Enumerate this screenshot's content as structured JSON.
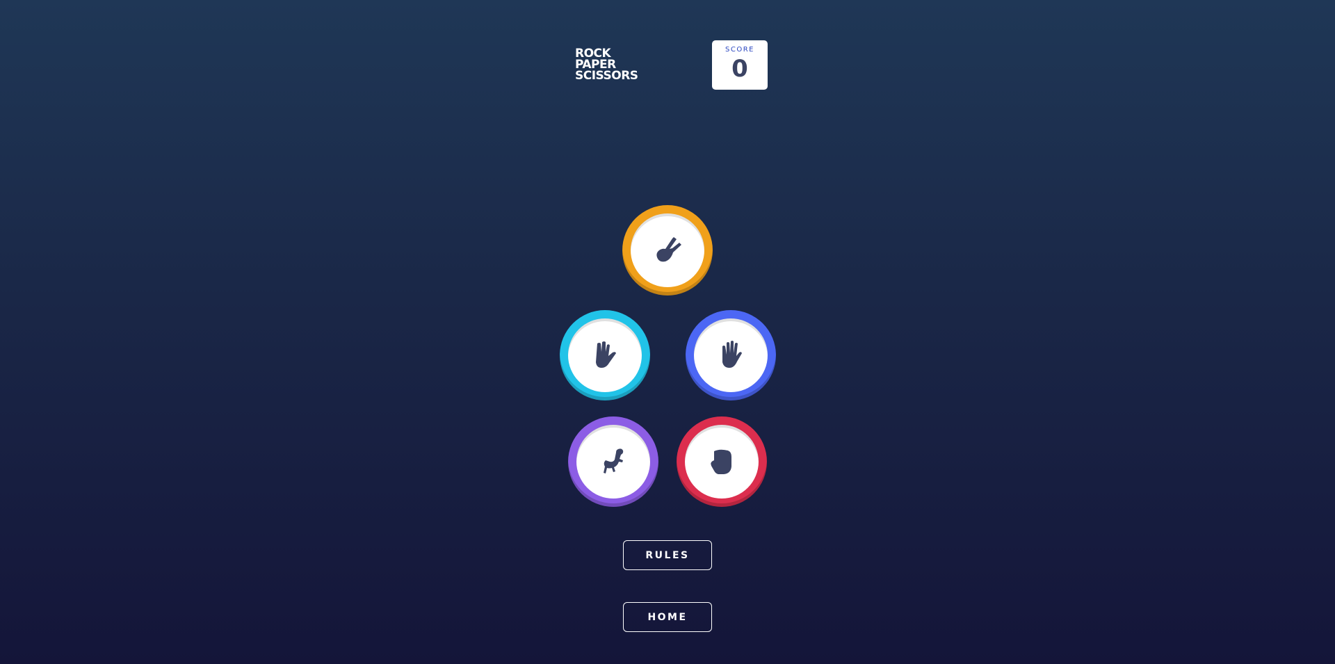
{
  "header": {
    "title_lines": [
      "ROCK",
      "PAPER",
      "SCISSORS"
    ],
    "score_label": "SCORE",
    "score_value": "0"
  },
  "tokens": [
    {
      "name": "scissors",
      "color": "#f0a01a",
      "icon": "scissors-icon"
    },
    {
      "name": "spock",
      "color": "#21c3e8",
      "icon": "spock-icon"
    },
    {
      "name": "paper",
      "color": "#4c67f4",
      "icon": "paper-icon"
    },
    {
      "name": "lizard",
      "color": "#8c5de5",
      "icon": "lizard-icon"
    },
    {
      "name": "rock",
      "color": "#dc2e4e",
      "icon": "rock-icon"
    }
  ],
  "buttons": {
    "rules": "RULES",
    "home": "HOME"
  }
}
